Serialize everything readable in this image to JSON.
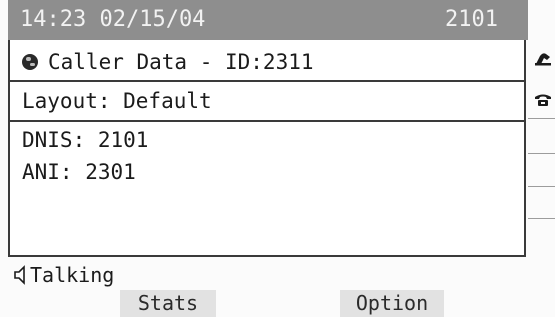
{
  "status": {
    "datetime": "14:23 02/15/04",
    "extension": "2101"
  },
  "caller": {
    "title": "Caller Data - ID:2311",
    "layout": "Layout: Default",
    "dnis": "DNIS: 2101",
    "ani": "ANI: 2301"
  },
  "call_state": {
    "label": "Talking"
  },
  "softkeys": {
    "stats": "Stats",
    "option": "Option"
  },
  "line_icons": [
    "handset-off-hook-icon",
    "phone-icon"
  ],
  "colors": {
    "status_bar_bg": "#8e8e8e",
    "status_bar_text": "#f2f2f2",
    "softkey_bg": "#e2e2e2"
  }
}
